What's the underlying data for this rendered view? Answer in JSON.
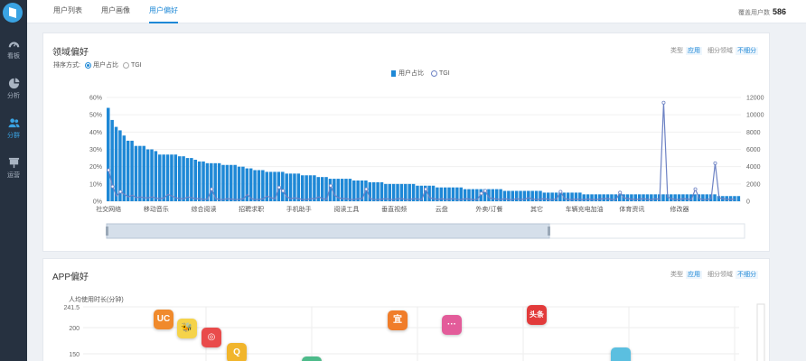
{
  "sidebar": {
    "items": [
      {
        "label": "看板",
        "icon": "dashboard-icon"
      },
      {
        "label": "分析",
        "icon": "pie-chart-icon"
      },
      {
        "label": "分群",
        "icon": "users-icon"
      },
      {
        "label": "运营",
        "icon": "board-icon"
      }
    ],
    "active": 2
  },
  "tabs": [
    "用户列表",
    "用户画像",
    "用户偏好"
  ],
  "active_tab": 2,
  "coverage": {
    "label": "覆盖用户数",
    "value": "586"
  },
  "domain_panel": {
    "title": "领域偏好",
    "type_label": "类型",
    "type_value": "应用",
    "sub_label": "细分领域",
    "sub_value": "不细分",
    "sort_label": "排序方式:",
    "sort_options": [
      "用户占比",
      "TGI"
    ],
    "legend": [
      "用户占比",
      "TGI"
    ]
  },
  "app_panel": {
    "title": "APP偏好",
    "type_label": "类型",
    "type_value": "应用",
    "sub_label": "细分领域",
    "sub_value": "不细分",
    "y_title": "人均使用时长(分钟)",
    "y_ticks": [
      "241.5",
      "200",
      "150"
    ],
    "icons": [
      {
        "text": "UC",
        "color": "#f08a2c"
      },
      {
        "text": "🐝",
        "color": "#f5d34a"
      },
      {
        "text": "◎",
        "color": "#e94b4b"
      },
      {
        "text": "Q",
        "color": "#f1b52c"
      },
      {
        "text": "宜",
        "color": "#f07d2a"
      },
      {
        "text": "···",
        "color": "#e35c9a"
      },
      {
        "text": "头条",
        "color": "#e23b3b"
      }
    ]
  },
  "colors": {
    "bar": "#1e88d6",
    "tgi": "#6d82c4",
    "accent": "#1e88d6"
  },
  "chart_data": {
    "type": "bar",
    "x_tick_labels": [
      "社交网络",
      "移动音乐",
      "综合阅读",
      "招聘求职",
      "手机助手",
      "阅读工具",
      "垂直视频",
      "云盘",
      "外卖/订餐",
      "其它",
      "车辆充电加油",
      "体育资讯",
      "修改器"
    ],
    "y_ticks_left": [
      "60%",
      "50%",
      "40%",
      "30%",
      "20%",
      "10%",
      "0%"
    ],
    "y_ticks_right": [
      "12000",
      "10000",
      "8000",
      "6000",
      "4000",
      "2000",
      "0"
    ],
    "ylim_left": [
      0,
      60
    ],
    "ylim_right": [
      0,
      12000
    ],
    "series": [
      {
        "name": "用户占比",
        "axis": "left",
        "values": [
          54,
          47,
          43,
          41,
          38,
          35,
          35,
          32,
          32,
          32,
          30,
          30,
          29,
          27,
          27,
          27,
          27,
          27,
          26,
          26,
          25,
          25,
          24,
          23,
          23,
          22,
          22,
          22,
          22,
          21,
          21,
          21,
          21,
          20,
          20,
          19,
          19,
          18,
          18,
          18,
          17,
          17,
          17,
          17,
          17,
          16,
          16,
          16,
          16,
          15,
          15,
          15,
          15,
          14,
          14,
          14,
          13,
          13,
          13,
          13,
          13,
          13,
          12,
          12,
          12,
          12,
          11,
          11,
          11,
          11,
          10,
          10,
          10,
          10,
          10,
          10,
          10,
          10,
          9,
          9,
          9,
          9,
          9,
          8,
          8,
          8,
          8,
          8,
          8,
          8,
          7,
          7,
          7,
          7,
          7,
          7,
          7,
          7,
          7,
          7,
          6,
          6,
          6,
          6,
          6,
          6,
          6,
          6,
          6,
          6,
          5,
          5,
          5,
          5,
          5,
          5,
          5,
          5,
          5,
          5,
          4,
          4,
          4,
          4,
          4,
          4,
          4,
          4,
          4,
          4,
          4,
          4,
          4,
          4,
          4,
          4,
          4,
          4,
          4,
          4,
          4,
          4,
          4,
          4,
          4,
          4,
          4,
          4,
          4,
          4,
          4,
          4,
          4,
          4,
          3,
          3,
          3,
          3,
          3,
          3
        ]
      },
      {
        "name": "TGI",
        "axis": "right",
        "values": [
          3600,
          1700,
          600,
          1100,
          800,
          500,
          700,
          400,
          500,
          400,
          400,
          500,
          350,
          300,
          400,
          800,
          600,
          400,
          300,
          300,
          500,
          400,
          300,
          300,
          200,
          250,
          1400,
          300,
          200,
          200,
          300,
          250,
          200,
          200,
          300,
          800,
          300,
          200,
          200,
          300,
          600,
          400,
          300,
          1600,
          1200,
          500,
          300,
          400,
          300,
          200,
          200,
          300,
          300,
          500,
          300,
          200,
          1800,
          700,
          400,
          300,
          300,
          200,
          200,
          300,
          300,
          1400,
          300,
          200,
          200,
          250,
          300,
          200,
          200,
          300,
          300,
          200,
          200,
          300,
          250,
          200,
          1400,
          400,
          300,
          200,
          300,
          200,
          250,
          300,
          200,
          200,
          300,
          250,
          200,
          200,
          900,
          1200,
          400,
          300,
          250,
          200,
          300,
          200,
          200,
          300,
          200,
          250,
          400,
          250,
          200,
          250,
          300,
          200,
          200,
          250,
          1100,
          300,
          200,
          200,
          250,
          200,
          200,
          250,
          200,
          200,
          250,
          300,
          300,
          200,
          200,
          1000,
          400,
          300,
          250,
          200,
          250,
          300,
          200,
          200,
          300,
          200,
          11400,
          500,
          300,
          200,
          200,
          300,
          250,
          200,
          1400,
          300,
          200,
          200,
          300,
          4400,
          400,
          300,
          200,
          250,
          200
        ]
      }
    ]
  }
}
